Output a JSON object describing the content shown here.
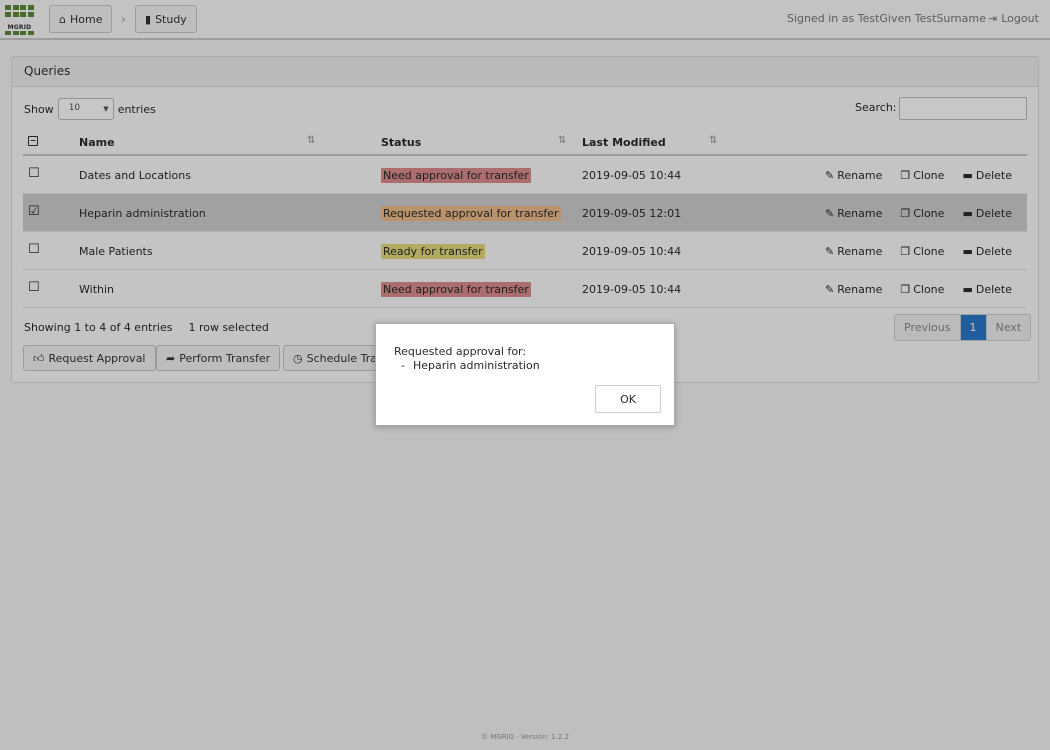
{
  "nav": {
    "logo_text": "MGRID",
    "home_label": "Home",
    "study_label": "Study",
    "signed_in": "Signed in as TestGiven TestSurname",
    "logout_label": "Logout"
  },
  "panel": {
    "title": "Queries",
    "show_label": "Show",
    "entries_label": "entries",
    "page_size": "10",
    "search_label": "Search:",
    "search_value": ""
  },
  "table": {
    "headers": {
      "name": "Name",
      "status": "Status",
      "modified": "Last Modified"
    },
    "rows": [
      {
        "name": "Dates and Locations",
        "status": "Need approval for transfer",
        "modified": "2019-09-05 10:44",
        "checked": "☐"
      },
      {
        "name": "Heparin administration",
        "status": "Requested approval for transfer",
        "modified": "2019-09-05 12:01",
        "checked": "☑"
      },
      {
        "name": "Male Patients",
        "status": "Ready for transfer",
        "modified": "2019-09-05 10:44",
        "checked": "☐"
      },
      {
        "name": "Within",
        "status": "Need approval for transfer",
        "modified": "2019-09-05 10:44",
        "checked": "☐"
      }
    ],
    "action_rename": "Rename",
    "action_clone": "Clone",
    "action_delete": "Delete"
  },
  "footer_info": {
    "showing": "Showing 1 to 4 of 4 entries",
    "selected": "1 row selected"
  },
  "pager": {
    "previous": "Previous",
    "current": "1",
    "next": "Next"
  },
  "buttons": {
    "request_approval": "Request Approval",
    "perform_transfer": "Perform Transfer",
    "schedule_transfer": "Schedule Tra"
  },
  "modal": {
    "message": "Requested approval for:",
    "bullet": "-",
    "item": "Heparin administration",
    "ok": "OK"
  },
  "footer": "© MGRID · Version: 1.2.2",
  "colors": {
    "need": "#dc8c8c",
    "requested": "#efbd8b",
    "ready": "#e4dc7a"
  },
  "icons": {
    "home": "home-icon",
    "study": "book-icon",
    "logout": "logout-icon",
    "rename": "edit-icon",
    "clone": "copy-icon",
    "delete": "trash-icon",
    "request": "thumbs-up-icon",
    "perform": "share-icon",
    "schedule": "clock-icon"
  }
}
